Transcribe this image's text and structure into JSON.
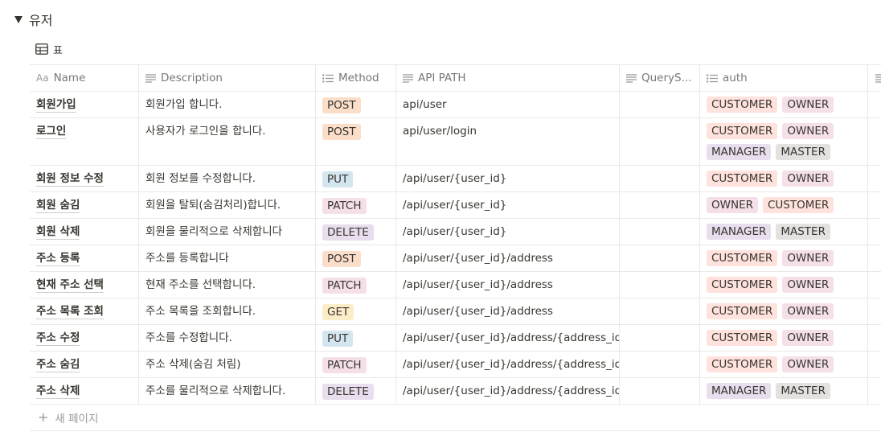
{
  "section": {
    "title": "유저"
  },
  "view": {
    "label": "표"
  },
  "columns": [
    {
      "label": "Name",
      "icon": "Aa"
    },
    {
      "label": "Description",
      "icon": "text-icon"
    },
    {
      "label": "Method",
      "icon": "list-icon"
    },
    {
      "label": "API PATH",
      "icon": "text-icon"
    },
    {
      "label": "QueryS...",
      "icon": "text-icon"
    },
    {
      "label": "auth",
      "icon": "list-icon"
    }
  ],
  "tag_colors": {
    "POST": "#fadec9",
    "PUT": "#d3e5ef",
    "PATCH": "#f5e0e9",
    "DELETE": "#e8deee",
    "GET": "#fdecc8",
    "CUSTOMER": "#ffe2dd",
    "OWNER": "#f5e0e9",
    "MANAGER": "#e8deee",
    "MASTER": "#e3e2e0"
  },
  "rows": [
    {
      "name": "회원가입",
      "description": "회원가입 합니다.",
      "method": "POST",
      "path": "api/user",
      "query": "",
      "auth": [
        "CUSTOMER",
        "OWNER"
      ]
    },
    {
      "name": "로그인",
      "description": "사용자가 로그인을 합니다.",
      "method": "POST",
      "path": "api/user/login",
      "query": "",
      "auth": [
        "CUSTOMER",
        "OWNER",
        "MANAGER",
        "MASTER"
      ]
    },
    {
      "name": "회원 정보 수정",
      "description": "회원 정보를 수정합니다.",
      "method": "PUT",
      "path": "/api/user/{user_id}",
      "query": "",
      "auth": [
        "CUSTOMER",
        "OWNER"
      ]
    },
    {
      "name": "회원 숨김",
      "description": "회원을 탈퇴(숨김처리)합니다.",
      "method": "PATCH",
      "path": "/api/user/{user_id}",
      "query": "",
      "auth": [
        "OWNER",
        "CUSTOMER"
      ]
    },
    {
      "name": "회원 삭제",
      "description": "회원을 물리적으로 삭제합니다",
      "method": "DELETE",
      "path": "/api/user/{user_id}",
      "query": "",
      "auth": [
        "MANAGER",
        "MASTER"
      ]
    },
    {
      "name": "주소 등록",
      "description": "주소를 등록합니다",
      "method": "POST",
      "path": "/api/user/{user_id}/address",
      "query": "",
      "auth": [
        "CUSTOMER",
        "OWNER"
      ]
    },
    {
      "name": "현재 주소 선택",
      "description": "현재 주소를 선택합니다.",
      "method": "PATCH",
      "path": "/api/user/{user_id}/address",
      "query": "",
      "auth": [
        "CUSTOMER",
        "OWNER"
      ]
    },
    {
      "name": "주소 목록 조회",
      "description": "주소 목록을 조회합니다.",
      "method": "GET",
      "path": "/api/user/{user_id}/address",
      "query": "",
      "auth": [
        "CUSTOMER",
        "OWNER"
      ]
    },
    {
      "name": "주소 수정",
      "description": "주소를 수정합니다.",
      "method": "PUT",
      "path": "/api/user/{user_id}/address/{address_id}",
      "query": "",
      "auth": [
        "CUSTOMER",
        "OWNER"
      ]
    },
    {
      "name": "주소 숨김",
      "description": "주소 삭제(숨김 처림)",
      "method": "PATCH",
      "path": "/api/user/{user_id}/address/{address_id}",
      "query": "",
      "auth": [
        "CUSTOMER",
        "OWNER"
      ]
    },
    {
      "name": "주소 삭제",
      "description": "주소를 물리적으로 삭제합니다.",
      "method": "DELETE",
      "path": "/api/user/{user_id}/address/{address_id}",
      "query": "",
      "auth": [
        "MANAGER",
        "MASTER"
      ]
    }
  ],
  "footer": {
    "new_page_label": "새 페이지"
  }
}
